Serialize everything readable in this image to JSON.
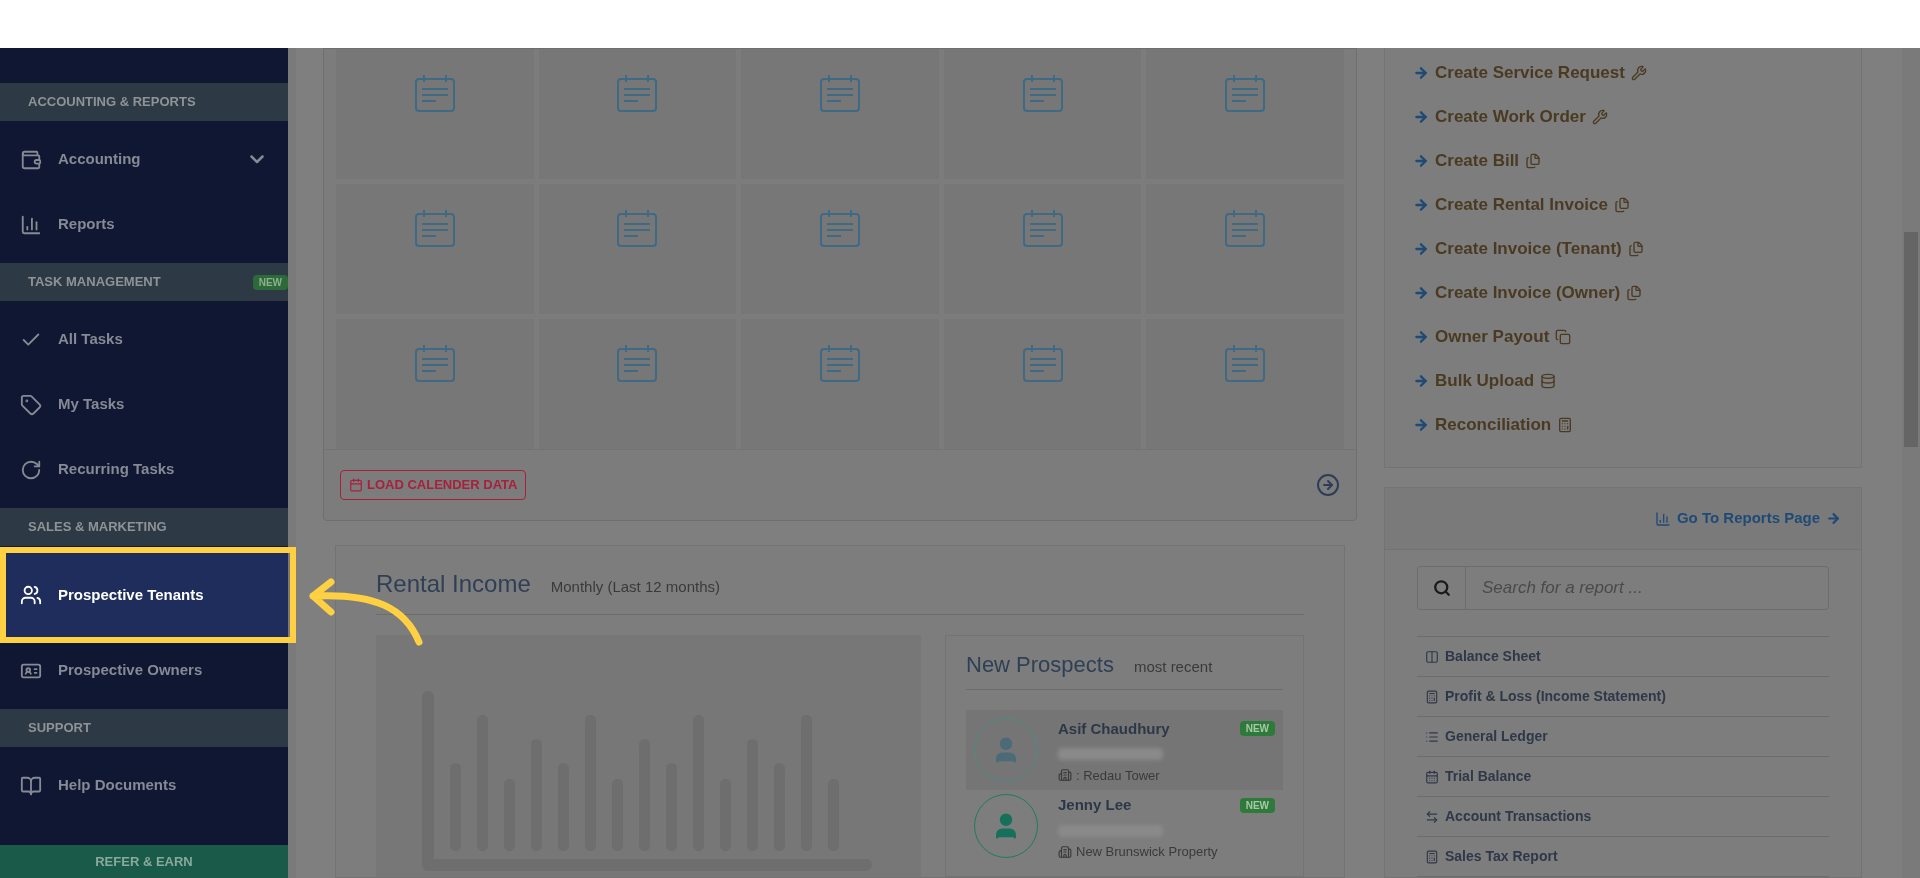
{
  "sidebar": {
    "sections": [
      {
        "title": "ACCOUNTING & REPORTS",
        "items": [
          {
            "label": "Accounting",
            "selected": false,
            "expandable": true
          },
          {
            "label": "Reports",
            "selected": false,
            "expandable": false
          }
        ]
      },
      {
        "title": "TASK MANAGEMENT",
        "badge": "NEW",
        "items": [
          {
            "label": "All Tasks",
            "selected": false,
            "expandable": false
          },
          {
            "label": "My Tasks",
            "selected": false,
            "expandable": false
          },
          {
            "label": "Recurring Tasks",
            "selected": false,
            "expandable": false
          }
        ]
      },
      {
        "title": "SALES & MARKETING",
        "items": [
          {
            "label": "Prospective Tenants",
            "selected": true,
            "expandable": false
          },
          {
            "label": "Prospective Owners",
            "selected": false,
            "expandable": false
          }
        ]
      },
      {
        "title": "SUPPORT",
        "items": [
          {
            "label": "Help Documents",
            "selected": false,
            "expandable": false
          }
        ]
      }
    ],
    "refer_button": "REFER & EARN"
  },
  "calendar": {
    "load_button": "LOAD CALENDER DATA"
  },
  "rental_income": {
    "title": "Rental Income",
    "subtitle": "Monthly (Last 12 months)"
  },
  "new_prospects": {
    "title": "New Prospects",
    "subtitle": "most recent",
    "items": [
      {
        "name": "Asif Chaudhury",
        "badge": "NEW",
        "property": ": Redau Tower",
        "selected": true
      },
      {
        "name": "Jenny Lee",
        "badge": "NEW",
        "property": "New Brunswick Property",
        "selected": false
      }
    ]
  },
  "quick_actions": [
    {
      "label": "Create Service Request"
    },
    {
      "label": "Create Work Order"
    },
    {
      "label": "Create Bill"
    },
    {
      "label": "Create Rental Invoice"
    },
    {
      "label": "Create Invoice (Tenant)"
    },
    {
      "label": "Create Invoice (Owner)"
    },
    {
      "label": "Owner Payout"
    },
    {
      "label": "Bulk Upload"
    },
    {
      "label": "Reconciliation"
    }
  ],
  "reports": {
    "link": "Go To Reports Page",
    "search": {
      "placeholder": "Search for a report ..."
    },
    "items": [
      {
        "label": "Balance Sheet"
      },
      {
        "label": "Profit & Loss (Income Statement)"
      },
      {
        "label": "General Ledger"
      },
      {
        "label": "Trial Balance"
      },
      {
        "label": "Account Transactions"
      },
      {
        "label": "Sales Tax Report"
      }
    ]
  }
}
